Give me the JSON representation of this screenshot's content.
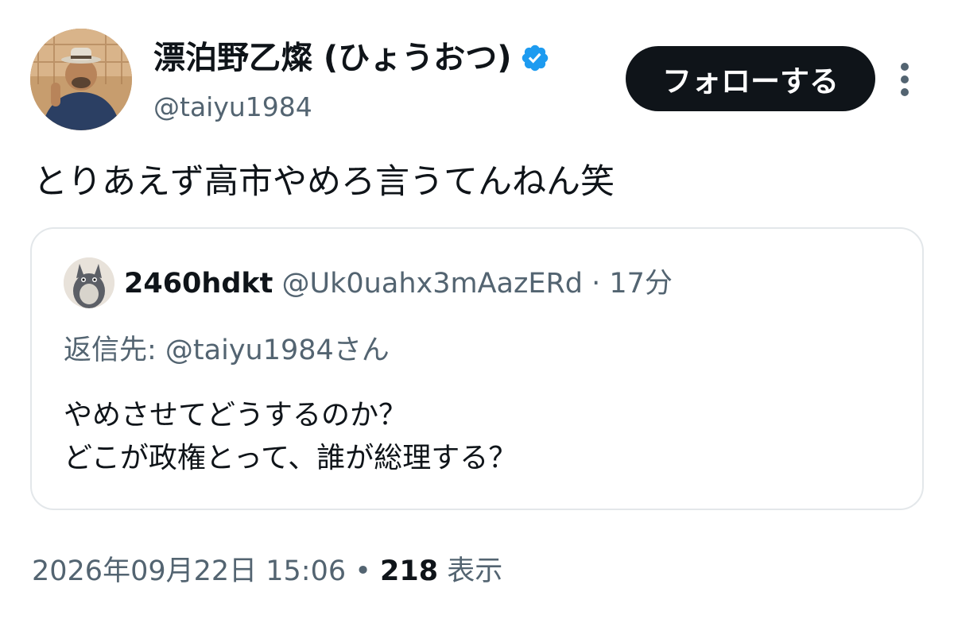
{
  "author": {
    "display_name": "漂泊野乙燦 (ひょうおつ)",
    "handle": "@taiyu1984",
    "verified": true,
    "avatar_icon": "profile-photo-man-in-hat-waving"
  },
  "follow_button": {
    "label": "フォローする"
  },
  "more_icon": "more-vertical-icon",
  "tweet": {
    "text": "とりあえず高市やめろ言うてんねん笑"
  },
  "quote": {
    "name": "2460hdkt",
    "handle": "@Uk0uahx3mAazERd",
    "separator": " · ",
    "time": "17分",
    "reply_to": "返信先: @taiyu1984さん",
    "text": "やめさせてどうするのか？\nどこが政権とって、誰が総理する？",
    "avatar_icon": "totoro-plush-avatar"
  },
  "meta": {
    "timestamp": "2026年09月22日 15:06",
    "separator": " • ",
    "views": "218",
    "views_label": " 表示"
  },
  "colors": {
    "text": "#0f1419",
    "secondary": "#536471",
    "verified": "#1d9bf0",
    "follow_bg": "#0f1419",
    "border": "#e3e7ea"
  }
}
